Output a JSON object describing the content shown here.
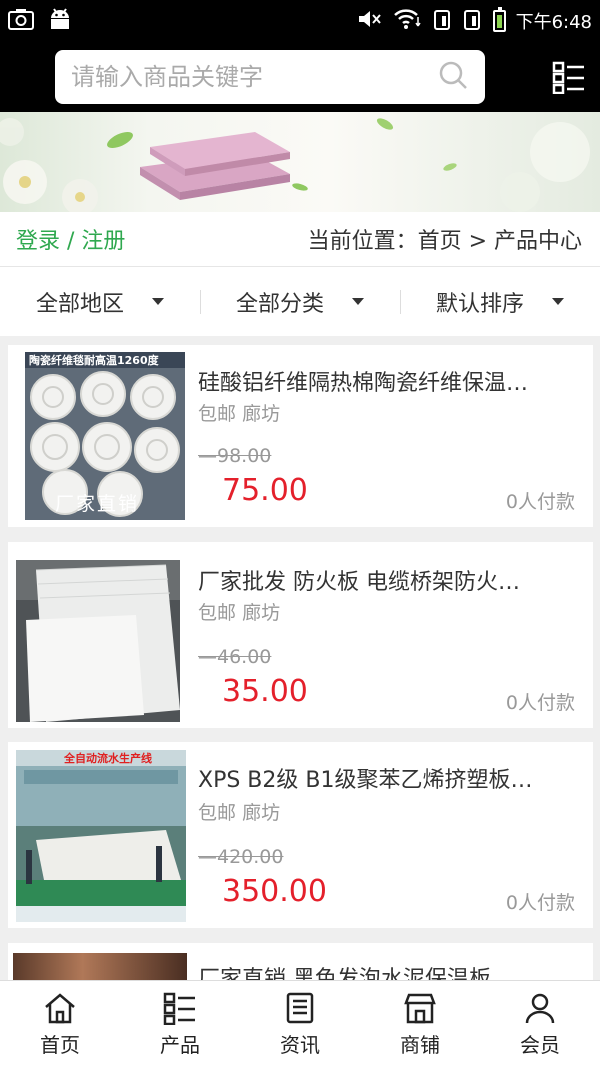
{
  "status_bar": {
    "time": "下午6:48"
  },
  "search": {
    "placeholder": "请输入商品关键字"
  },
  "nav_bar": {
    "login_label": "登录 / 注册",
    "breadcrumb": "当前位置：首页 > 产品中心"
  },
  "filters": [
    {
      "label": "全部地区"
    },
    {
      "label": "全部分类"
    },
    {
      "label": "默认排序"
    }
  ],
  "products": [
    {
      "title": "硅酸铝纤维隔热棉陶瓷纤维保温…",
      "shipping": "包邮",
      "location": "廊坊",
      "old_price": "98.00",
      "price": "75.00",
      "buyers": "0人付款",
      "image_caption_top": "陶瓷纤维毯耐高温1260度",
      "image_caption_bottom": "厂家直销"
    },
    {
      "title": "厂家批发 防火板 电缆桥架防火…",
      "shipping": "包邮",
      "location": "廊坊",
      "old_price": "46.00",
      "price": "35.00",
      "buyers": "0人付款"
    },
    {
      "title": "XPS B2级 B1级聚苯乙烯挤塑板…",
      "shipping": "包邮",
      "location": "廊坊",
      "old_price": "420.00",
      "price": "350.00",
      "buyers": "0人付款",
      "image_caption_top": "全自动流水生产线"
    },
    {
      "title": "厂家直销 黑色发泡水泥保温板 …"
    }
  ],
  "bottom_nav": [
    {
      "label": "首页",
      "icon": "home-icon"
    },
    {
      "label": "产品",
      "icon": "product-grid-icon"
    },
    {
      "label": "资讯",
      "icon": "news-icon"
    },
    {
      "label": "商铺",
      "icon": "store-icon"
    },
    {
      "label": "会员",
      "icon": "user-icon"
    }
  ],
  "colors": {
    "accent": "#2fa84f",
    "price": "#e4202b",
    "header": "#000000"
  }
}
